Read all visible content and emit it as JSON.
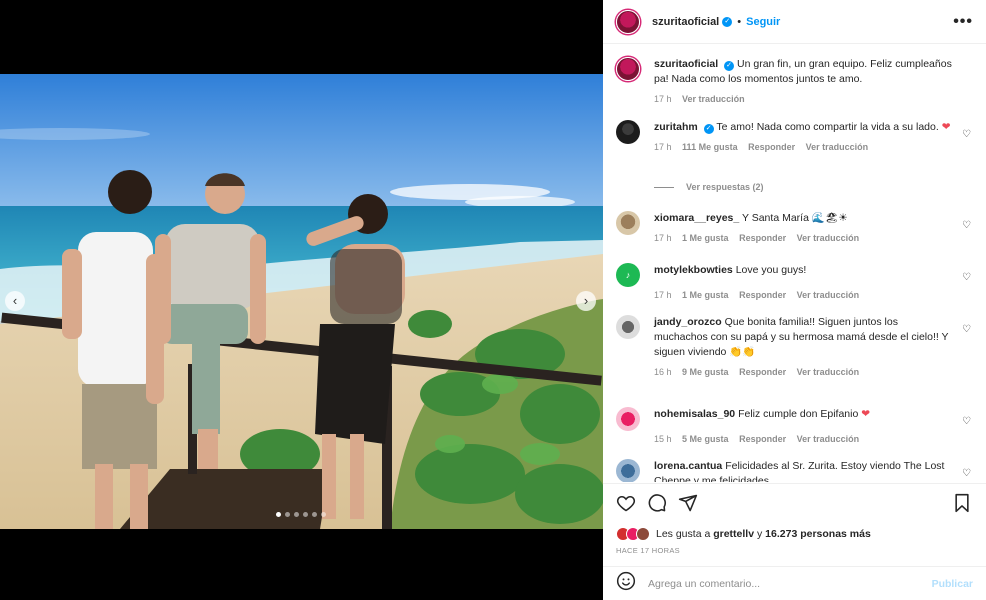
{
  "header": {
    "username": "szuritaoficial",
    "separator": "•",
    "follow_label": "Seguir",
    "more_label": "•••"
  },
  "media": {
    "prev_icon": "‹",
    "next_icon": "›",
    "dots_total": 6,
    "dots_active_index": 0
  },
  "caption": {
    "username": "szuritaoficial",
    "text": "Un gran fin, un gran equipo. Feliz cumpleaños pa! Nada como los momentos juntos te amo.",
    "time": "17 h",
    "translate": "Ver traducción"
  },
  "comments": [
    {
      "username": "zuritahm",
      "verified": true,
      "text": "Te amo! Nada como compartir la vida a su lado.",
      "emoji": "❤",
      "time": "17 h",
      "likes": "111 Me gusta",
      "reply": "Responder",
      "translate": "Ver traducción",
      "view_replies": "Ver respuestas (2)"
    },
    {
      "username": "xiomara__reyes_",
      "text": "Y Santa María",
      "emoji": "🌊🏖☀",
      "time": "17 h",
      "likes": "1 Me gusta",
      "reply": "Responder",
      "translate": "Ver traducción"
    },
    {
      "username": "motylekbowties",
      "text": "Love you guys!",
      "time": "17 h",
      "likes": "1 Me gusta",
      "reply": "Responder",
      "translate": "Ver traducción"
    },
    {
      "username": "jandy_orozco",
      "text": "Que bonita familia!! Siguen juntos los muchachos con su papá y su hermosa mamá desde el cielo!! Y siguen viviendo",
      "emoji": "👏👏",
      "time": "16 h",
      "likes": "9 Me gusta",
      "reply": "Responder",
      "translate": "Ver traducción"
    },
    {
      "username": "nohemisalas_90",
      "text": "Feliz cumple don Epifanio",
      "emoji": "❤",
      "time": "15 h",
      "likes": "5 Me gusta",
      "reply": "Responder",
      "translate": "Ver traducción"
    },
    {
      "username": "lorena.cantua",
      "text": "Felicidades al Sr. Zurita. Estoy viendo The Lost Cheppe y me felicidades",
      "time": "",
      "likes": "",
      "reply": "",
      "translate": ""
    }
  ],
  "likes_summary": {
    "prefix": "Les gusta a",
    "user": "grettellv",
    "middle": "y",
    "count": "16.273 personas más"
  },
  "posted": "HACE 17 HORAS",
  "add_comment": {
    "placeholder": "Agrega un comentario...",
    "publish_label": "Publicar"
  },
  "colors": {
    "link_blue": "#0095f6",
    "publish_disabled": "#b2dffc",
    "secondary_text": "#8e8e8e",
    "heart_red": "#ed4956"
  }
}
